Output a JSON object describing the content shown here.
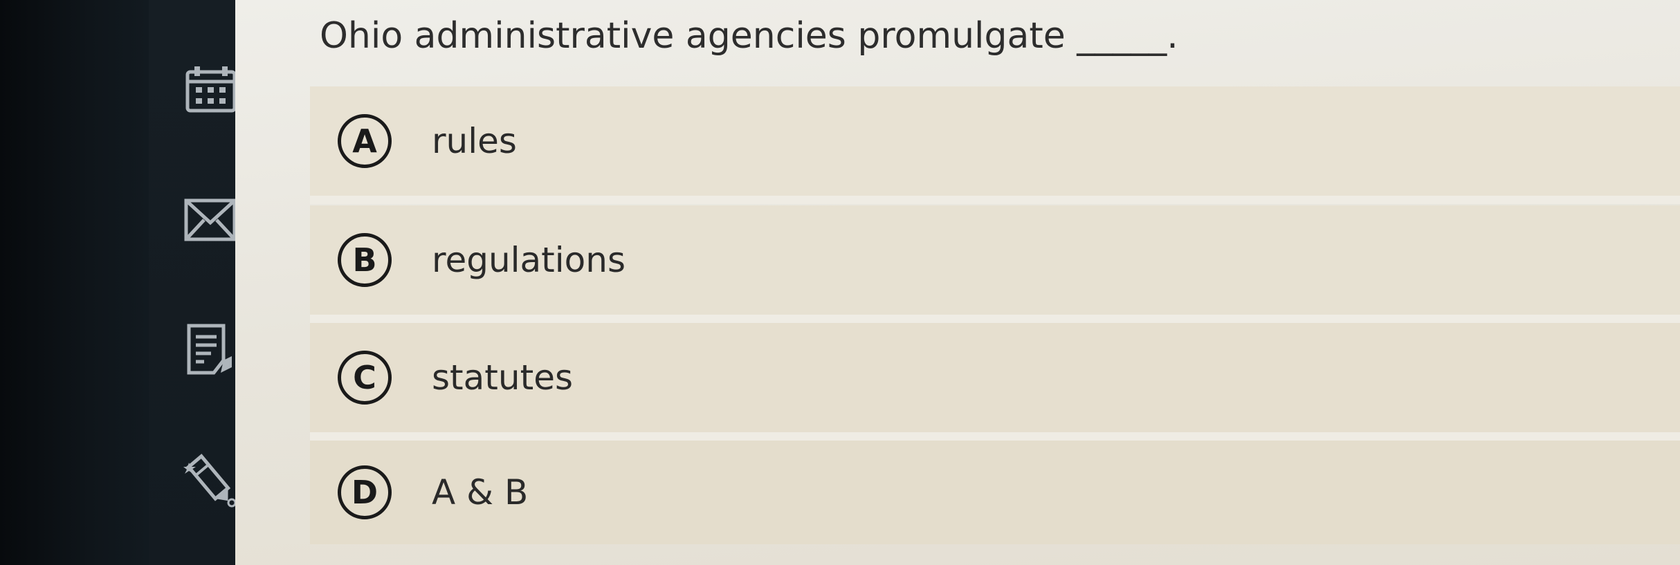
{
  "question": {
    "text": "Ohio administrative agencies promulgate _____."
  },
  "options": [
    {
      "letter": "A",
      "text": "rules"
    },
    {
      "letter": "B",
      "text": "regulations"
    },
    {
      "letter": "C",
      "text": "statutes"
    },
    {
      "letter": "D",
      "text": "A & B"
    }
  ],
  "sidebar": {
    "icons": [
      "calendar-icon",
      "mail-icon",
      "notes-icon",
      "pencil-icon"
    ]
  }
}
